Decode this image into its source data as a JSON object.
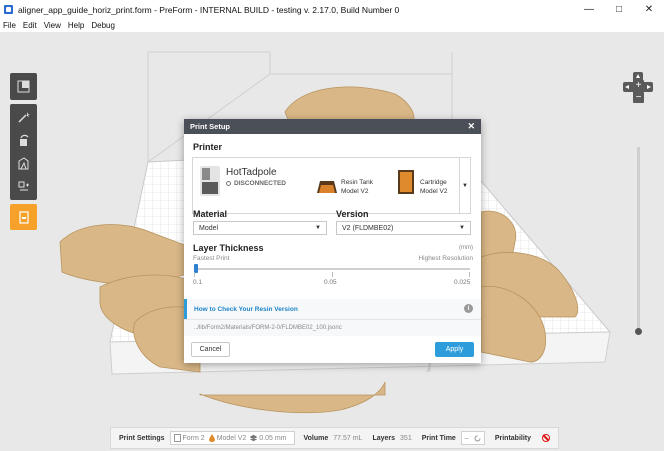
{
  "window": {
    "title": "aligner_app_guide_horiz_print.form - PreForm - INTERNAL BUILD - testing v. 2.17.0, Build Number 0",
    "minimize": "—",
    "maximize": "□",
    "close": "✕"
  },
  "menu": [
    "File",
    "Edit",
    "View",
    "Help",
    "Debug"
  ],
  "nav": {
    "zoom_in": "+",
    "zoom_out": "−"
  },
  "status_bar": {
    "print_settings_label": "Print Settings",
    "printer": "Form 2",
    "material": "Model V2",
    "layer": "0.05 mm",
    "volume_label": "Volume",
    "volume_value": "77.57 mL",
    "layers_label": "Layers",
    "layers_value": "351",
    "print_time_label": "Print Time",
    "print_time_value": "–",
    "printability_label": "Printability"
  },
  "dialog": {
    "title": "Print Setup",
    "close": "✕",
    "printer_heading": "Printer",
    "printer_name": "HotTadpole",
    "printer_status": "DISCONNECTED",
    "resin_tank_line1": "Resin Tank",
    "resin_tank_line2": "Model V2",
    "cartridge_line1": "Cartridge",
    "cartridge_line2": "Model V2",
    "material_heading": "Material",
    "material_value": "Model",
    "version_heading": "Version",
    "version_value": "V2 (FLDMBE02)",
    "layer_heading": "Layer Thickness",
    "layer_unit": "(mm)",
    "fastest_label": "Fastest Print",
    "highest_label": "Highest Resolution",
    "ticks": [
      "0.1",
      "0.05",
      "0.025"
    ],
    "slider_fraction": 0.0,
    "help_link": "How to Check Your Resin Version",
    "info": "i",
    "path": "../lib/Form2/Materials/FORM-2-0/FLDMBE02_100.jsonc",
    "cancel": "Cancel",
    "apply": "Apply"
  },
  "colors": {
    "accent": "#2d9cdb",
    "tool_active": "#f5a12a",
    "model": "#d9b787",
    "header": "#4b4f57"
  }
}
